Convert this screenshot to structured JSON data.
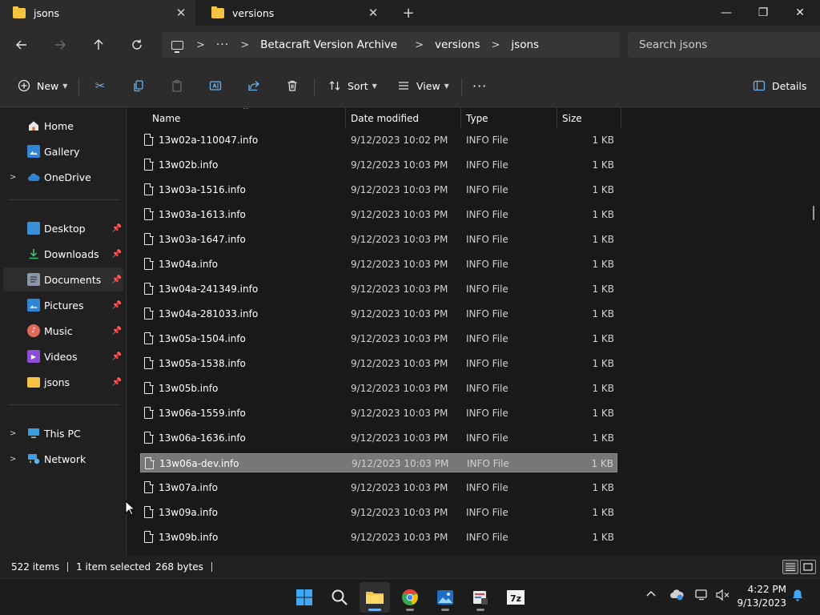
{
  "tabs": [
    {
      "title": "jsons",
      "active": true
    },
    {
      "title": "versions",
      "active": false
    }
  ],
  "window": {
    "minimize": "—",
    "maximize": "❐",
    "close": "✕",
    "new_tab": "+"
  },
  "breadcrumb": [
    "Betacraft Version Archive",
    "versions",
    "jsons"
  ],
  "search": {
    "placeholder": "Search jsons"
  },
  "toolbar": {
    "new_label": "New",
    "sort_label": "Sort",
    "view_label": "View",
    "more_label": "···",
    "details_label": "Details"
  },
  "sidebar": {
    "top": [
      {
        "label": "Home",
        "icon": "home-icon"
      },
      {
        "label": "Gallery",
        "icon": "gallery-icon"
      },
      {
        "label": "OneDrive",
        "icon": "cloud-icon"
      }
    ],
    "quick_access": [
      {
        "label": "Desktop",
        "icon": "desktop-icon"
      },
      {
        "label": "Downloads",
        "icon": "download-icon"
      },
      {
        "label": "Documents",
        "icon": "documents-icon",
        "selected": true
      },
      {
        "label": "Pictures",
        "icon": "pictures-icon"
      },
      {
        "label": "Music",
        "icon": "music-icon"
      },
      {
        "label": "Videos",
        "icon": "videos-icon"
      },
      {
        "label": "jsons",
        "icon": "folder-icon"
      }
    ],
    "bottom": [
      {
        "label": "This PC",
        "icon": "pc-icon"
      },
      {
        "label": "Network",
        "icon": "network-icon"
      }
    ]
  },
  "columns": {
    "name": "Name",
    "date": "Date modified",
    "type": "Type",
    "size": "Size"
  },
  "files": [
    {
      "name": "13w02a-110047.info",
      "date": "9/12/2023 10:02 PM",
      "type": "INFO File",
      "size": "1 KB"
    },
    {
      "name": "13w02b.info",
      "date": "9/12/2023 10:03 PM",
      "type": "INFO File",
      "size": "1 KB"
    },
    {
      "name": "13w03a-1516.info",
      "date": "9/12/2023 10:03 PM",
      "type": "INFO File",
      "size": "1 KB"
    },
    {
      "name": "13w03a-1613.info",
      "date": "9/12/2023 10:03 PM",
      "type": "INFO File",
      "size": "1 KB"
    },
    {
      "name": "13w03a-1647.info",
      "date": "9/12/2023 10:03 PM",
      "type": "INFO File",
      "size": "1 KB"
    },
    {
      "name": "13w04a.info",
      "date": "9/12/2023 10:03 PM",
      "type": "INFO File",
      "size": "1 KB"
    },
    {
      "name": "13w04a-241349.info",
      "date": "9/12/2023 10:03 PM",
      "type": "INFO File",
      "size": "1 KB"
    },
    {
      "name": "13w04a-281033.info",
      "date": "9/12/2023 10:03 PM",
      "type": "INFO File",
      "size": "1 KB"
    },
    {
      "name": "13w05a-1504.info",
      "date": "9/12/2023 10:03 PM",
      "type": "INFO File",
      "size": "1 KB"
    },
    {
      "name": "13w05a-1538.info",
      "date": "9/12/2023 10:03 PM",
      "type": "INFO File",
      "size": "1 KB"
    },
    {
      "name": "13w05b.info",
      "date": "9/12/2023 10:03 PM",
      "type": "INFO File",
      "size": "1 KB"
    },
    {
      "name": "13w06a-1559.info",
      "date": "9/12/2023 10:03 PM",
      "type": "INFO File",
      "size": "1 KB"
    },
    {
      "name": "13w06a-1636.info",
      "date": "9/12/2023 10:03 PM",
      "type": "INFO File",
      "size": "1 KB"
    },
    {
      "name": "13w06a-dev.info",
      "date": "9/12/2023 10:03 PM",
      "type": "INFO File",
      "size": "1 KB",
      "selected": true
    },
    {
      "name": "13w07a.info",
      "date": "9/12/2023 10:03 PM",
      "type": "INFO File",
      "size": "1 KB"
    },
    {
      "name": "13w09a.info",
      "date": "9/12/2023 10:03 PM",
      "type": "INFO File",
      "size": "1 KB"
    },
    {
      "name": "13w09b.info",
      "date": "9/12/2023 10:03 PM",
      "type": "INFO File",
      "size": "1 KB"
    }
  ],
  "status": {
    "items": "522 items",
    "selected": "1 item selected",
    "size": "268 bytes"
  },
  "clock": {
    "time": "4:22 PM",
    "date": "9/13/2023"
  },
  "colors": {
    "accent": "#6cb3f2",
    "folder": "#f5c242",
    "selection": "#777777"
  }
}
